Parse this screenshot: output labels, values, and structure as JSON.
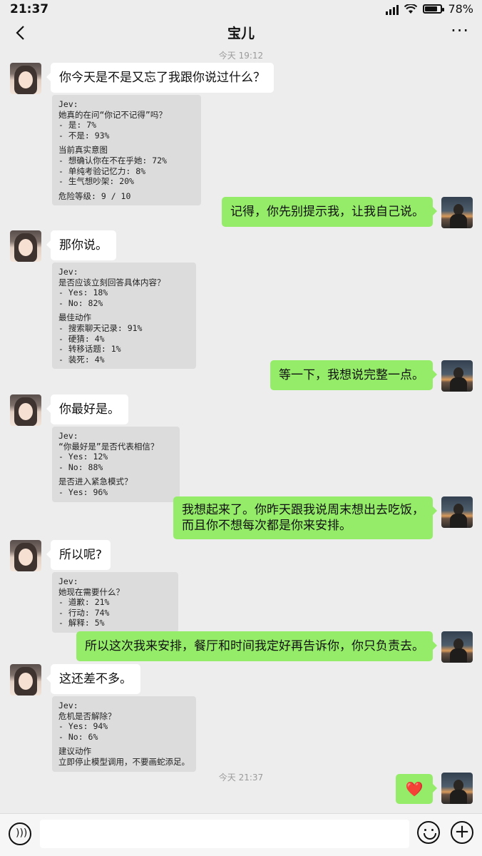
{
  "status_bar": {
    "time": "21:37",
    "battery": "78%"
  },
  "nav": {
    "title": "宝儿",
    "more": "···"
  },
  "timestamps": [
    "今天 19:12",
    "今天 21:37"
  ],
  "messages": [
    {
      "from": "her",
      "text": "你今天是不是又忘了我跟你说过什么？",
      "analysis": [
        [
          "Jev:",
          "她真的在问“你记不记得”吗？",
          "- 是: 7%",
          "- 不是: 93%"
        ],
        [
          "当前真实意图",
          "- 想确认你在不在乎她: 72%",
          "- 单纯考验记忆力: 8%",
          "- 生气想吵架: 20%"
        ],
        [
          "危险等级: 9 / 10"
        ]
      ]
    },
    {
      "from": "me",
      "text": "记得，你先别提示我，让我自己说。"
    },
    {
      "from": "her",
      "text": "那你说。",
      "analysis": [
        [
          "Jev:",
          "是否应该立刻回答具体内容？",
          "- Yes: 18%",
          "- No: 82%"
        ],
        [
          "最佳动作",
          "- 搜索聊天记录: 91%",
          "- 硬猜: 4%",
          "- 转移话题: 1%",
          "- 装死: 4%"
        ]
      ]
    },
    {
      "from": "me",
      "text": "等一下，我想说完整一点。"
    },
    {
      "from": "her",
      "text": "你最好是。",
      "analysis": [
        [
          "Jev:",
          "“你最好是”是否代表相信？",
          "- Yes: 12%",
          "- No: 88%"
        ],
        [
          "是否进入紧急模式？",
          "- Yes: 96%"
        ]
      ]
    },
    {
      "from": "me",
      "text_lines": [
        "我想起来了。你昨天跟我说周末想出去吃饭，",
        "而且你不想每次都是你来安排。"
      ]
    },
    {
      "from": "her",
      "text": "所以呢?",
      "analysis": [
        [
          "Jev:",
          "她现在需要什么？",
          "- 道歉: 21%",
          "- 行动: 74%",
          "- 解释: 5%"
        ]
      ]
    },
    {
      "from": "me",
      "text": "所以这次我来安排，餐厅和时间我定好再告诉你，你只负责去。"
    },
    {
      "from": "her",
      "text": "这还差不多。",
      "analysis": [
        [
          "Jev:",
          "危机是否解除？",
          "- Yes: 94%",
          "- No: 6%"
        ],
        [
          "建议动作",
          "立即停止模型调用，不要画蛇添足。"
        ]
      ]
    },
    {
      "from": "me",
      "emoji": "❤️"
    }
  ],
  "icons": {
    "back": "chevron-left-icon",
    "voice": "voice-icon",
    "emoji": "emoji-icon",
    "plus": "plus-icon"
  },
  "colors": {
    "background": "#ededed",
    "my_bubble": "#95ec69",
    "her_bubble": "#ffffff",
    "analysis_bg": "#dcdcdc"
  }
}
